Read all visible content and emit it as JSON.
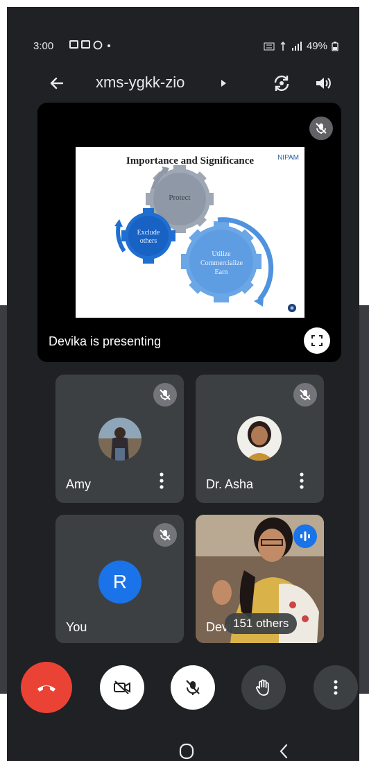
{
  "status_bar": {
    "time": "3:00",
    "battery": "49%"
  },
  "header": {
    "meeting_code": "xms-ygkk-zio"
  },
  "presentation": {
    "slide": {
      "title": "Importance and Significance",
      "logo": "NIPAM",
      "gears": [
        "Protect",
        "Exclude others",
        "Utilize Commercialize Earn"
      ]
    },
    "caption": "Devika is presenting"
  },
  "participants": [
    {
      "name": "Amy",
      "muted": true
    },
    {
      "name": "Dr. Asha",
      "muted": true
    },
    {
      "name": "You",
      "initial": "R",
      "muted": true
    },
    {
      "name": "Devi",
      "speaking": true
    }
  ],
  "others_badge": "151 others",
  "colors": {
    "end_call": "#ea4335",
    "avatar_blue": "#1a73e8",
    "background": "#202124",
    "tile": "#3c4043"
  }
}
